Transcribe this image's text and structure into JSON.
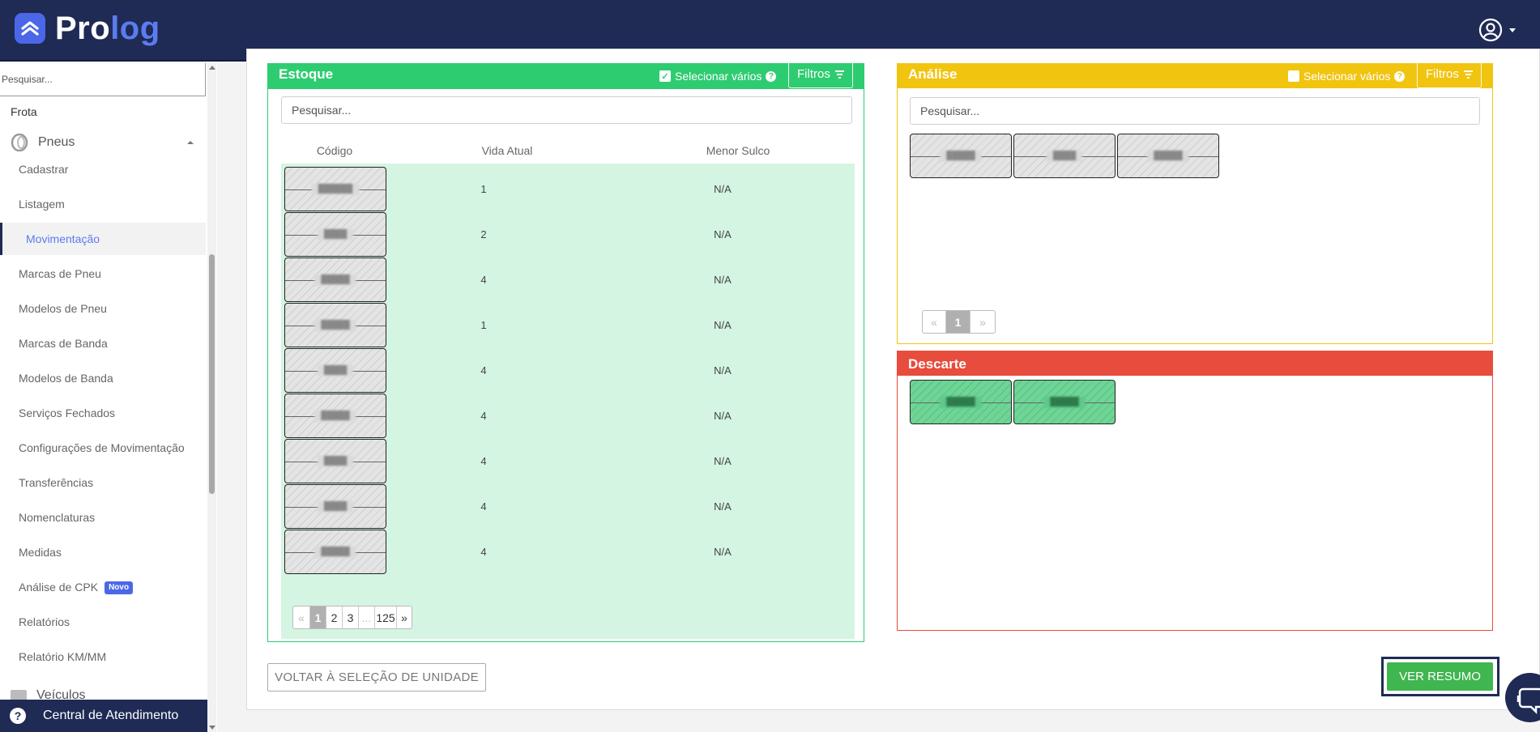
{
  "app": {
    "logo_pro": "Pro",
    "logo_log": "log"
  },
  "sidebar": {
    "search_placeholder": "Pesquisar...",
    "section_label": "Frota",
    "group_label": "Pneus",
    "items": [
      {
        "label": "Cadastrar"
      },
      {
        "label": "Listagem"
      },
      {
        "label": "Movimentação"
      },
      {
        "label": "Marcas de Pneu"
      },
      {
        "label": "Modelos de Pneu"
      },
      {
        "label": "Marcas de Banda"
      },
      {
        "label": "Modelos de Banda"
      },
      {
        "label": "Serviços Fechados"
      },
      {
        "label": "Configurações de Movimentação"
      },
      {
        "label": "Transferências"
      },
      {
        "label": "Nomenclaturas"
      },
      {
        "label": "Medidas"
      },
      {
        "label": "Análise de CPK",
        "badge": "Novo"
      },
      {
        "label": "Relatórios"
      },
      {
        "label": "Relatório KM/MM"
      }
    ],
    "next_group": "Veículos",
    "help_label": "Central de Atendimento"
  },
  "estoque": {
    "title": "Estoque",
    "select_many": "Selecionar vários",
    "filters": "Filtros",
    "search_placeholder": "Pesquisar...",
    "columns": {
      "codigo": "Código",
      "vida": "Vida Atual",
      "sulco": "Menor Sulco"
    },
    "rows": [
      {
        "code": "██████",
        "vida": "1",
        "sulco": "N/A"
      },
      {
        "code": "████",
        "vida": "2",
        "sulco": "N/A"
      },
      {
        "code": "█████",
        "vida": "4",
        "sulco": "N/A"
      },
      {
        "code": "█████",
        "vida": "1",
        "sulco": "N/A"
      },
      {
        "code": "████",
        "vida": "4",
        "sulco": "N/A"
      },
      {
        "code": "█████",
        "vida": "4",
        "sulco": "N/A"
      },
      {
        "code": "████",
        "vida": "4",
        "sulco": "N/A"
      },
      {
        "code": "████",
        "vida": "4",
        "sulco": "N/A"
      },
      {
        "code": "█████",
        "vida": "4",
        "sulco": "N/A"
      }
    ],
    "pagination": {
      "prev": "«",
      "pages": [
        "1",
        "2",
        "3",
        "...",
        "125"
      ],
      "current": "1",
      "next": "»"
    }
  },
  "analise": {
    "title": "Análise",
    "select_many": "Selecionar vários",
    "filters": "Filtros",
    "search_placeholder": "Pesquisar...",
    "tires": [
      "█████",
      "████",
      "█████"
    ],
    "pagination": {
      "prev": "«",
      "current": "1",
      "next": "»"
    }
  },
  "descarte": {
    "title": "Descarte",
    "tires": [
      "█████",
      "█████"
    ]
  },
  "actions": {
    "back": "VOLTAR À SELEÇÃO DE UNIDADE",
    "summary": "VER RESUMO"
  },
  "colors": {
    "navy": "#1f2a55",
    "brand_blue": "#4b67e8",
    "estoque_green": "#2ecc71",
    "analise_yellow": "#f1c40f",
    "descarte_red": "#e74c3c",
    "summary_button": "#3fb64f"
  },
  "icons": [
    "user-circle-icon",
    "tire-icon",
    "check-icon",
    "question-icon",
    "filter-icon",
    "help-icon",
    "chat-icon"
  ]
}
